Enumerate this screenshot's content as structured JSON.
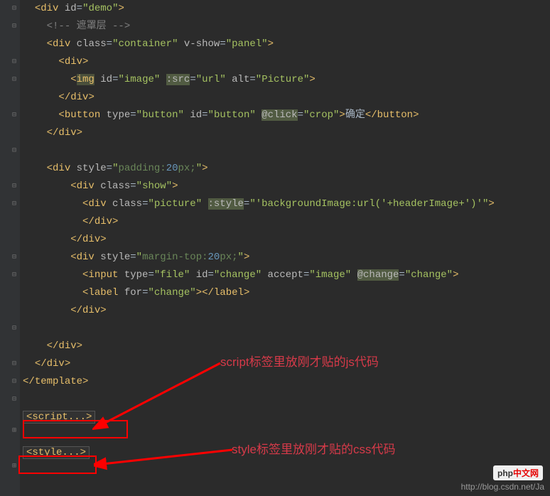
{
  "annotations": {
    "script_note": "script标签里放刚才贴的js代码",
    "style_note": "style标签里放刚才贴的css代码"
  },
  "collapsed": {
    "script": "script...",
    "style": "style..."
  },
  "watermark": {
    "url": "http://blog.csdn.net/Ja",
    "logo_text": "中文网",
    "logo_prefix": "php"
  },
  "code": {
    "l1": {
      "open": "<",
      "tag": "div",
      "sp": " ",
      "attr": "id",
      "eq": "=",
      "q": "\"",
      "val": "demo",
      "close": ">"
    },
    "l2": {
      "open": "<!-- ",
      "text": "遮罩层",
      "close": " -->"
    },
    "l3": {
      "open": "<",
      "tag": "div",
      "attr1": "class",
      "val1": "container",
      "attr2": "v-show",
      "val2": "panel",
      "close": ">"
    },
    "l4": {
      "open": "<",
      "tag": "div",
      "close": ">"
    },
    "l5": {
      "open": "<",
      "tag": "img",
      "attr1": "id",
      "val1": "image",
      "attr2": ":src",
      "val2": "url",
      "attr3": "alt",
      "val3": "Picture",
      "close": ">"
    },
    "l6": {
      "open": "</",
      "tag": "div",
      "close": ">"
    },
    "l7": {
      "open": "<",
      "tag": "button",
      "attr1": "type",
      "val1": "button",
      "attr2": "id",
      "val2": "button",
      "attr3": "@click",
      "val3": "crop",
      "text": "确定",
      "tagclose": "button",
      "close": ">"
    },
    "l8": {
      "open": "</",
      "tag": "div",
      "close": ">"
    },
    "l10": {
      "open": "<",
      "tag": "div",
      "attr": "style",
      "val_pre": "padding:",
      "val_num": "20",
      "val_post": "px;",
      "close": ">"
    },
    "l11": {
      "open": "<",
      "tag": "div",
      "attr": "class",
      "val": "show",
      "close": ">"
    },
    "l12": {
      "open": "<",
      "tag": "div",
      "attr1": "class",
      "val1": "picture",
      "attr2": ":style",
      "val2": "'backgroundImage:url('+headerImage+')'",
      "close": ">"
    },
    "l13": {
      "open": "</",
      "tag": "div",
      "close": ">"
    },
    "l14": {
      "open": "</",
      "tag": "div",
      "close": ">"
    },
    "l15": {
      "open": "<",
      "tag": "div",
      "attr": "style",
      "val_pre": "margin-top:",
      "val_num": "20",
      "val_post": "px;",
      "close": ">"
    },
    "l16": {
      "open": "<",
      "tag": "input",
      "attr1": "type",
      "val1": "file",
      "attr2": "id",
      "val2": "change",
      "attr3": "accept",
      "val3": "image",
      "attr4": "@change",
      "val4": "change",
      "close": ">"
    },
    "l17": {
      "open": "<",
      "tag": "label",
      "attr": "for",
      "val": "change",
      "tagclose": "label",
      "close": ">"
    },
    "l18": {
      "open": "</",
      "tag": "div",
      "close": ">"
    },
    "l20": {
      "open": "</",
      "tag": "div",
      "close": ">"
    },
    "l21": {
      "open": "</",
      "tag": "div",
      "close": ">"
    },
    "l22": {
      "open": "</",
      "tag": "template",
      "close": ">"
    }
  }
}
